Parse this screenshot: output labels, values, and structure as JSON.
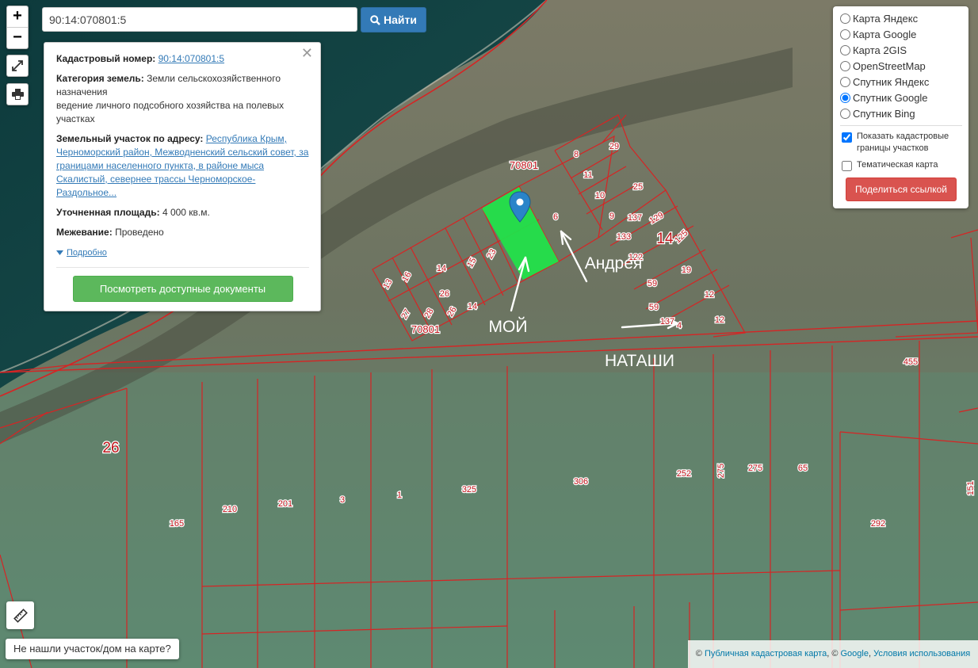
{
  "search": {
    "value": "90:14:070801:5",
    "button_label": "Найти"
  },
  "zoom": {
    "in_label": "+",
    "out_label": "−"
  },
  "info": {
    "cad_label": "Кадастровый номер:",
    "cad_value": "90:14:070801:5",
    "cat_label": "Категория земель:",
    "cat_value": "Земли сельскохозяйственного назначения",
    "use_value": "ведение личного подсобного хозяйства на полевых участках",
    "addr_label": "Земельный участок по адресу:",
    "addr_value": "Республика Крым, Черноморский район, Межводненский сельский совет, за границами населенного пункта, в районе мыса Скалистый, севернее трассы Черноморское-Раздольное...",
    "area_label": "Уточненная площадь:",
    "area_value": "4 000 кв.м.",
    "survey_label": "Межевание:",
    "survey_value": "Проведено",
    "more_label": "Подробно",
    "docs_button": "Посмотреть доступные документы"
  },
  "layers": {
    "base_options": [
      "Карта Яндекс",
      "Карта Google",
      "Карта 2GIS",
      "OpenStreetMap",
      "Спутник Яндекс",
      "Спутник Google",
      "Спутник Bing"
    ],
    "selected": "Спутник Google",
    "cadastral_label": "Показать кадастровые границы участков",
    "cadastral_checked": true,
    "thematic_label": "Тематическая карта",
    "thematic_checked": false,
    "share_button": "Поделиться ссылкой"
  },
  "tools": {
    "ruler_icon": "ruler-icon",
    "fullscreen_icon": "fullscreen-icon",
    "print_icon": "print-icon"
  },
  "not_found_label": "Не нашли участок/дом на карте?",
  "attribution": {
    "copy1": "©",
    "link1": "Публичная кадастровая карта",
    "sep": ", ©",
    "link2": "Google",
    "link3": "Условия использования"
  },
  "map": {
    "block_labels": [
      "70801",
      "70801"
    ],
    "large_labels": [
      "14",
      "26"
    ],
    "parcel_numbers": [
      "8",
      "29",
      "11",
      "10",
      "25",
      "9",
      "6",
      "137",
      "129",
      "133",
      "125",
      "122",
      "19",
      "59",
      "59",
      "12",
      "12",
      "137",
      "4",
      "13",
      "16",
      "14",
      "15",
      "23",
      "26",
      "27",
      "28",
      "26",
      "14",
      "455",
      "252",
      "275",
      "275",
      "65",
      "306",
      "325",
      "1",
      "3",
      "201",
      "210",
      "165",
      "292",
      "151"
    ],
    "annotations": [
      "МОЙ",
      "Андрея",
      "НАТАШИ"
    ],
    "selected_color": "#22e04a",
    "boundary_color": "#d62424"
  }
}
